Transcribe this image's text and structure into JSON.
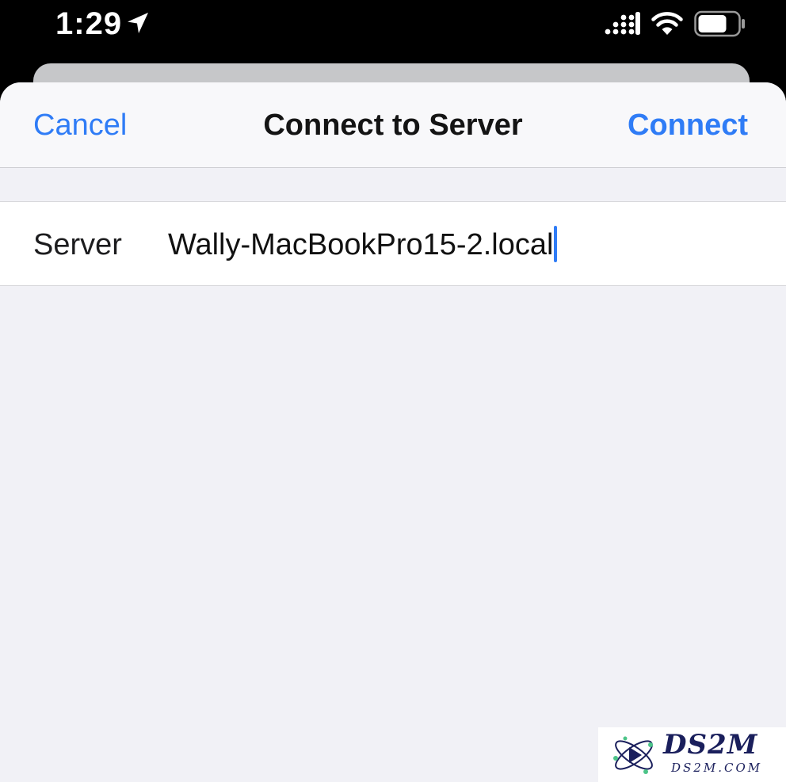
{
  "status_bar": {
    "time": "1:29",
    "icons": [
      "location-arrow-icon",
      "cellular-signal-icon",
      "wifi-icon",
      "battery-icon"
    ]
  },
  "nav": {
    "cancel_label": "Cancel",
    "title": "Connect to Server",
    "connect_label": "Connect"
  },
  "form": {
    "server_label": "Server",
    "server_value": "Wally-MacBookPro15-2.local"
  },
  "watermark": {
    "title": "DS2M",
    "subtitle": "DS2M.COM"
  },
  "colors": {
    "accent": "#2f7cf6",
    "status_bar_bg": "#000000",
    "sheet_bg": "#f1f1f6",
    "nav_bg": "#f8f8fa",
    "row_bg": "#ffffff"
  }
}
